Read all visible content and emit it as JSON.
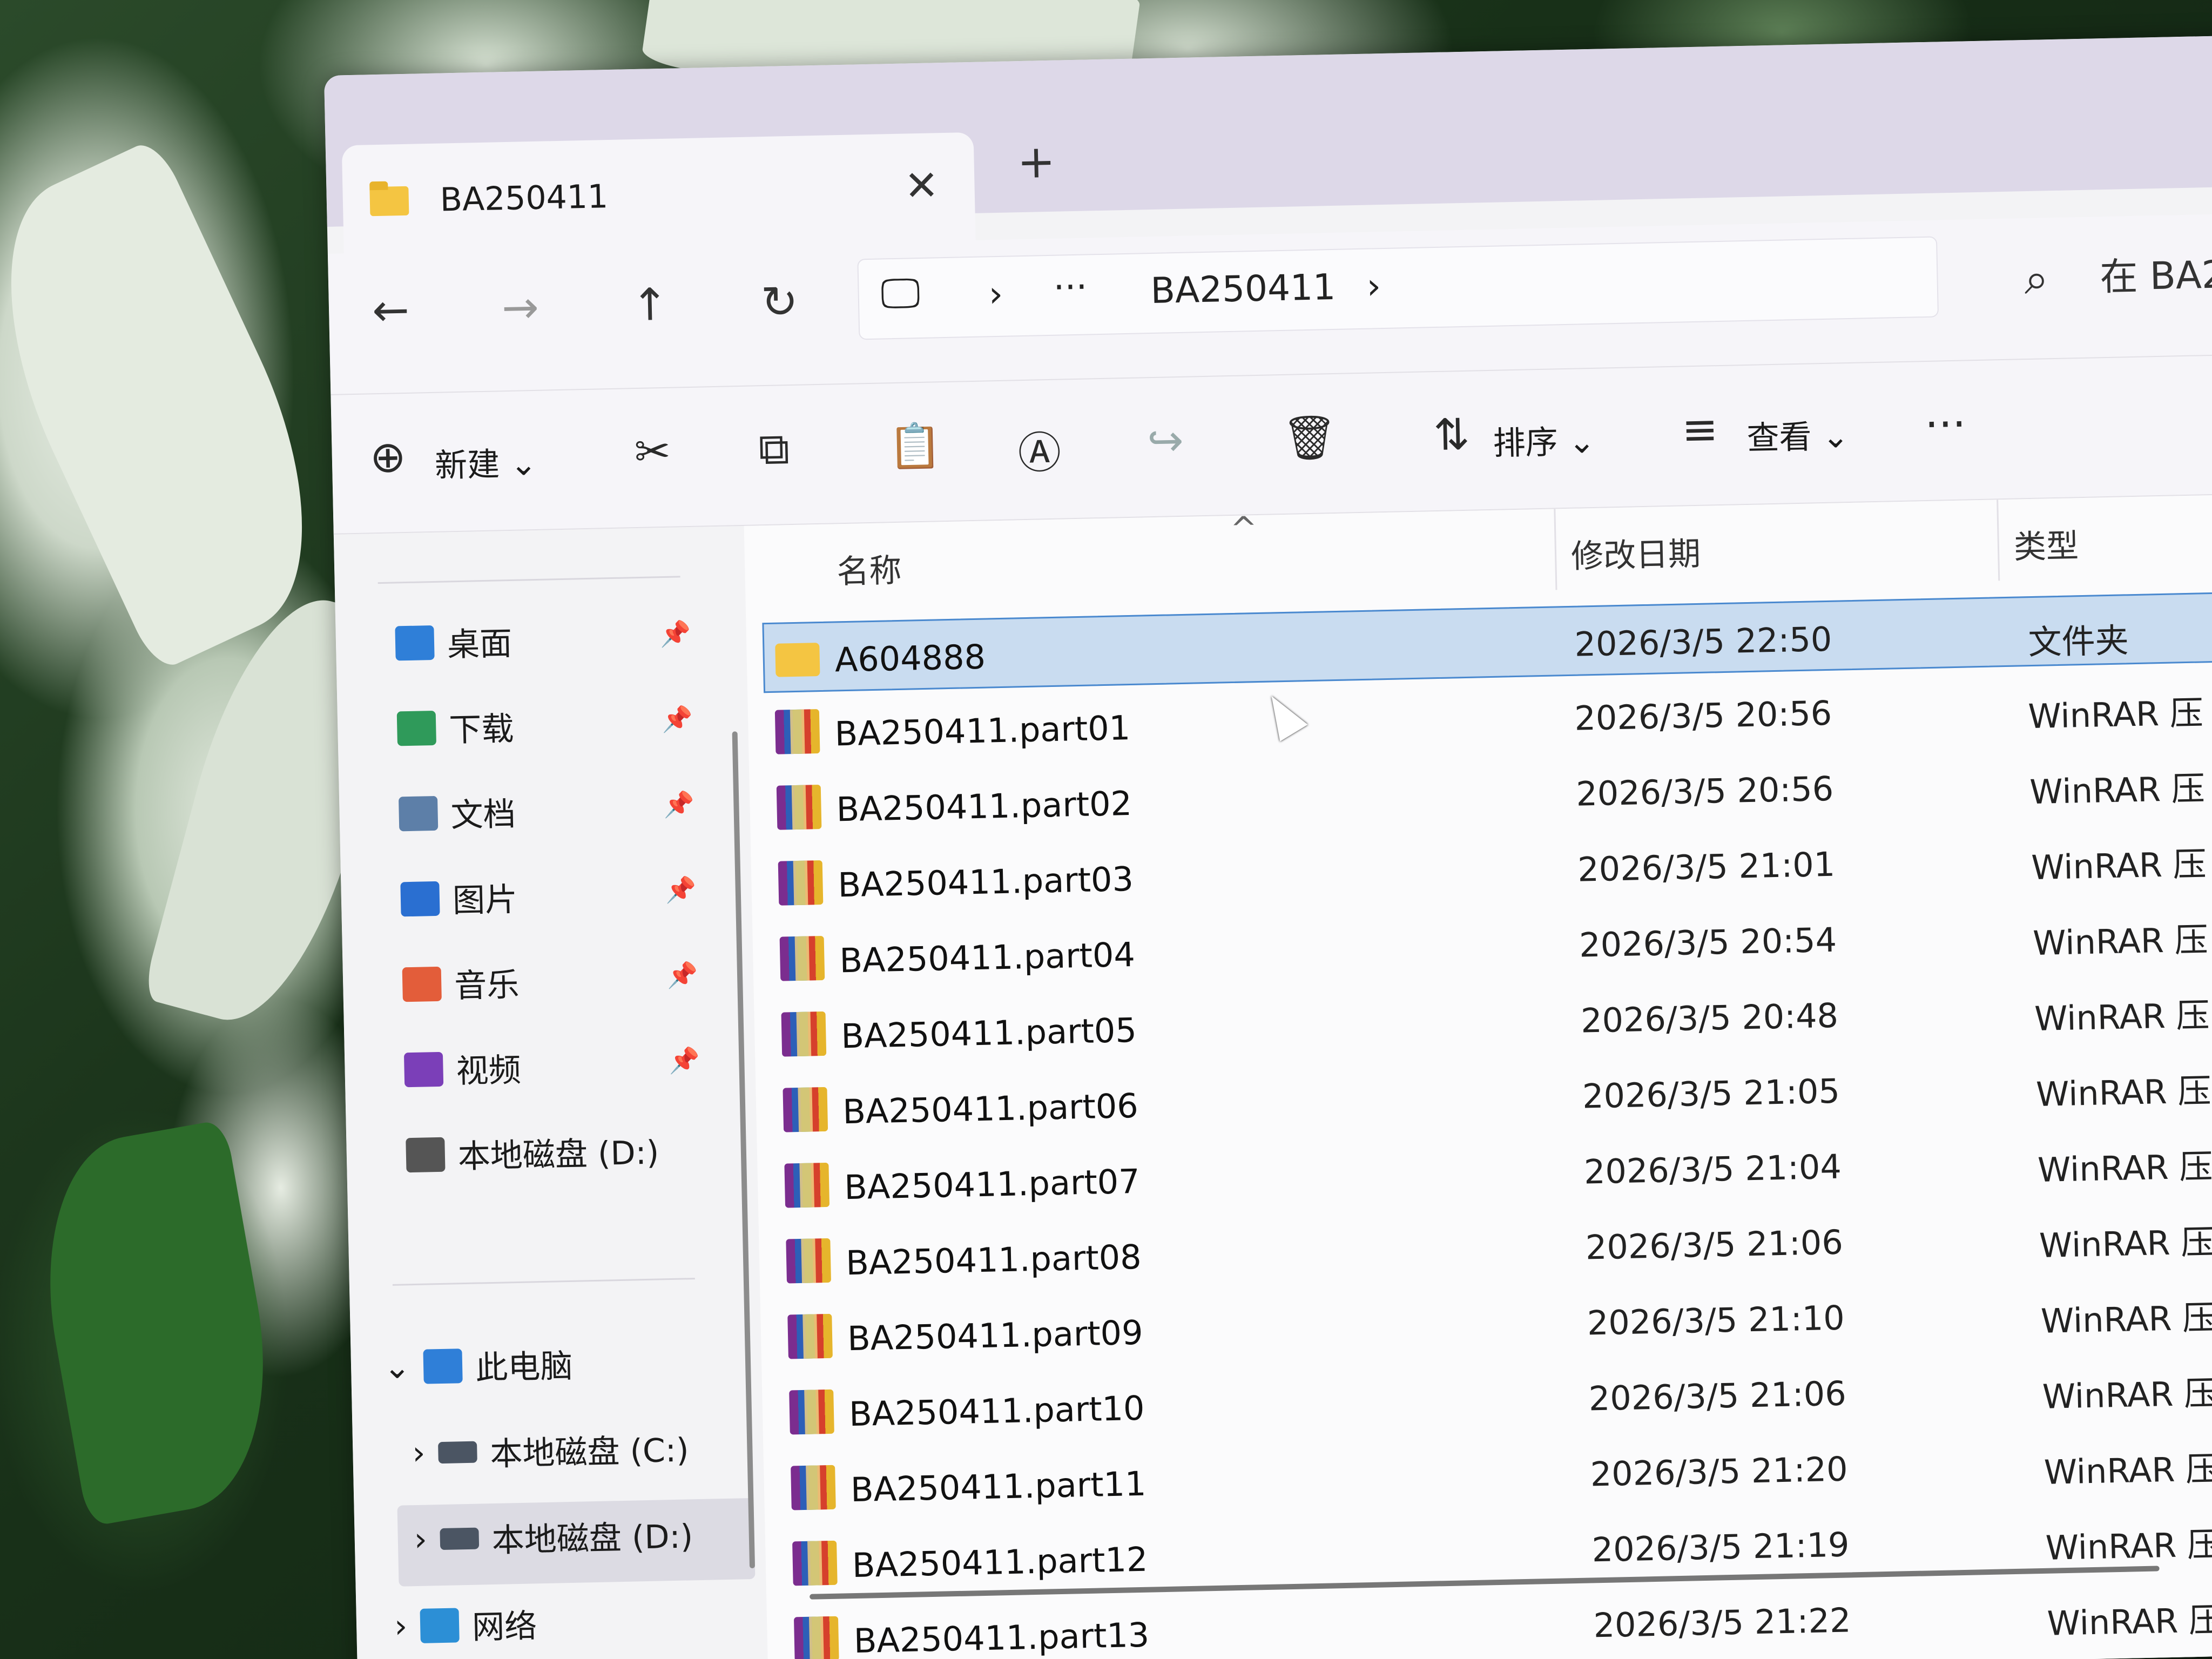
{
  "tab": {
    "title": "BA250411",
    "close": "✕",
    "new": "+"
  },
  "nav": {
    "back": "←",
    "forward": "→",
    "up": "↑",
    "refresh": "↻",
    "address": {
      "pc_icon": "🖵",
      "chevron1": "›",
      "more": "···",
      "folder": "BA250411",
      "chevron2": "›"
    },
    "search_icon": "⌕",
    "search_hint": "在 BA2"
  },
  "toolbar": {
    "new_label": "新建",
    "sort_label": "排序",
    "view_label": "查看",
    "more": "···"
  },
  "sidebar": {
    "quick": [
      {
        "label": "桌面",
        "color": "#2f7fd8"
      },
      {
        "label": "下载",
        "color": "#2f9a5a"
      },
      {
        "label": "文档",
        "color": "#5d7fa8"
      },
      {
        "label": "图片",
        "color": "#2a6fd1"
      },
      {
        "label": "音乐",
        "color": "#e35d3a"
      },
      {
        "label": "视频",
        "color": "#7b3fb8"
      },
      {
        "label": "本地磁盘 (D:)",
        "color": "#555555"
      }
    ],
    "this_pc": "此电脑",
    "drive_c": "本地磁盘 (C:)",
    "drive_d": "本地磁盘 (D:)",
    "network": "网络",
    "chevron_down": "⌄",
    "chevron_right": "›"
  },
  "columns": {
    "name": "名称",
    "date": "修改日期",
    "type": "类型",
    "sort_caret": "^"
  },
  "files": [
    {
      "name": "A604888",
      "date": "2026/3/5 22:50",
      "type": "文件夹",
      "kind": "folder"
    },
    {
      "name": "BA250411.part01",
      "date": "2026/3/5 20:56",
      "type": "WinRAR 压",
      "kind": "rar"
    },
    {
      "name": "BA250411.part02",
      "date": "2026/3/5 20:56",
      "type": "WinRAR 压",
      "kind": "rar"
    },
    {
      "name": "BA250411.part03",
      "date": "2026/3/5 21:01",
      "type": "WinRAR 压",
      "kind": "rar"
    },
    {
      "name": "BA250411.part04",
      "date": "2026/3/5 20:54",
      "type": "WinRAR 压",
      "kind": "rar"
    },
    {
      "name": "BA250411.part05",
      "date": "2026/3/5 20:48",
      "type": "WinRAR 压",
      "kind": "rar"
    },
    {
      "name": "BA250411.part06",
      "date": "2026/3/5 21:05",
      "type": "WinRAR 压",
      "kind": "rar"
    },
    {
      "name": "BA250411.part07",
      "date": "2026/3/5 21:04",
      "type": "WinRAR 压",
      "kind": "rar"
    },
    {
      "name": "BA250411.part08",
      "date": "2026/3/5 21:06",
      "type": "WinRAR 压",
      "kind": "rar"
    },
    {
      "name": "BA250411.part09",
      "date": "2026/3/5 21:10",
      "type": "WinRAR 压",
      "kind": "rar"
    },
    {
      "name": "BA250411.part10",
      "date": "2026/3/5 21:06",
      "type": "WinRAR 压",
      "kind": "rar"
    },
    {
      "name": "BA250411.part11",
      "date": "2026/3/5 21:20",
      "type": "WinRAR 压",
      "kind": "rar"
    },
    {
      "name": "BA250411.part12",
      "date": "2026/3/5 21:19",
      "type": "WinRAR 压",
      "kind": "rar"
    },
    {
      "name": "BA250411.part13",
      "date": "2026/3/5 21:22",
      "type": "WinRAR 压",
      "kind": "rar"
    }
  ]
}
